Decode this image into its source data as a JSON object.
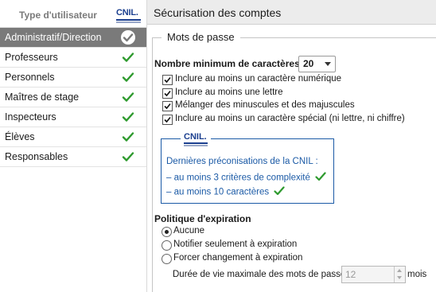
{
  "left_panel": {
    "header_title": "Type d'utilisateur",
    "logo_text": "CNIL.",
    "rows": [
      {
        "label": "Administratif/Direction",
        "selected": true
      },
      {
        "label": "Professeurs"
      },
      {
        "label": "Personnels"
      },
      {
        "label": "Maîtres de stage"
      },
      {
        "label": "Inspecteurs"
      },
      {
        "label": "Élèves"
      },
      {
        "label": "Responsables"
      }
    ]
  },
  "right_panel": {
    "title": "Sécurisation des comptes",
    "password_section": {
      "legend": "Mots de passe",
      "min_chars_label": "Nombre minimum de caractères",
      "min_chars_value": "20",
      "options": [
        {
          "label": "Inclure au moins un caractère numérique",
          "checked": true
        },
        {
          "label": "Inclure au moins une lettre",
          "checked": true
        },
        {
          "label": "Mélanger des minuscules et des majuscules",
          "checked": true
        },
        {
          "label": "Inclure au moins un caractère spécial (ni lettre, ni chiffre)",
          "checked": true
        }
      ]
    },
    "cnil_box": {
      "logo_text": "CNIL.",
      "intro": "Dernières préconisations de la CNIL :",
      "items": [
        "au moins 3 critères de complexité",
        "au moins 10 caractères"
      ]
    },
    "expiration": {
      "title": "Politique d'expiration",
      "options": [
        {
          "label": "Aucune",
          "selected": true
        },
        {
          "label": "Notifier seulement à expiration",
          "selected": false
        },
        {
          "label": "Forcer changement à expiration",
          "selected": false
        }
      ],
      "duration_label": "Durée de vie maximale des mots de passe :",
      "duration_value": "12",
      "duration_unit": "mois"
    }
  },
  "colors": {
    "check_green": "#2e9a2e",
    "selected_row_bg": "#7a7a7a",
    "cnil_blue": "#1b5aa6"
  }
}
